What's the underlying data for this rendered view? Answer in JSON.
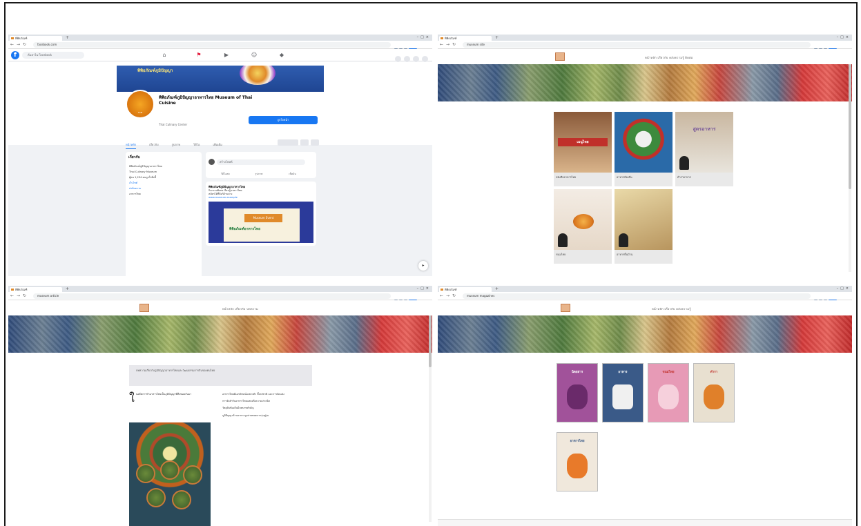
{
  "screens": {
    "facebook": {
      "tab_title": "พิพิธภัณฑ์",
      "url": "facebook.com",
      "search_placeholder": "ค้นหาใน Facebook",
      "cover_title": "พิพิธภัณฑ์ภูมิปัญญา",
      "page_name": "พิพิธภัณฑ์ภูมิปัญญาอาหารไทย Museum of Thai Cuisine",
      "page_subtitle": "Thai Culinary Center",
      "like_button": "ถูกใจหน้า",
      "tabs": [
        "หน้าหลัก",
        "เกี่ยวกับ",
        "รูปภาพ",
        "วิดีโอ",
        "เพิ่มเติม"
      ],
      "about_heading": "เกี่ยวกับ",
      "about_lines": [
        "พิพิธภัณฑ์ภูมิปัญญาอาหารไทย",
        "Thai Culinary Museum",
        "ผู้คน 1,234 คนถูกใจสิ่งนี้",
        "เว็บไซต์",
        "ส่งข้อความ",
        "อาหารไทย"
      ],
      "composer_placeholder": "สร้างโพสต์",
      "composer_actions": [
        "วิดีโอสด",
        "รูปภาพ",
        "เช็คอิน"
      ],
      "post_header": "พิพิธภัณฑ์ภูมิปัญญาอาหารไทย",
      "post_lines": [
        "กิจกรรมพิเศษ เรียนรู้อาหารไทย",
        "สมัครได้ที่ลิงก์ด้านล่าง",
        "www.museum.example"
      ],
      "post_image_title": "Museum Event",
      "post_image_subtitle": "พิพิธภัณฑ์อาหารไทย"
    },
    "books": {
      "tab_title": "พิพิธภัณฑ์",
      "url": "museum site",
      "menu": "หน้าหลัก  เกี่ยวกับ  คลังความรู้  ติดต่อ",
      "items": [
        {
          "title": "เมนูไทย",
          "caption": "หนังสืออาหารไทย"
        },
        {
          "title": "",
          "caption": "อาหารท้องถิ่น"
        },
        {
          "title": "สูตรอาหาร",
          "caption": "ตำราอาหาร"
        },
        {
          "title": "",
          "caption": "ขนมไทย"
        },
        {
          "title": "",
          "caption": "อาหารพื้นบ้าน"
        }
      ]
    },
    "article": {
      "tab_title": "พิพิธภัณฑ์",
      "url": "museum article",
      "menu": "หน้าหลัก  เกี่ยวกับ  บทความ",
      "intro": "บทความเกี่ยวกับภูมิปัญญาอาหารไทยและวัฒนธรรมการกินของคนไทย",
      "dropcap": "ใ",
      "left_paragraph": "นอดีตการทำอาหารไทยเป็นภูมิปัญญาที่สืบทอดกันมา",
      "right_paragraphs": [
        "อาหารไทยมีเอกลักษณ์เฉพาะตัว ทั้งรสชาติ และการจัดแต่ง",
        "การจัดสำรับอาหารไทยแสดงถึงความประณีต",
        "วัตถุดิบท้องถิ่นมีบทบาทสำคัญ",
        "ภูมิปัญญาด้านอาหารถูกถ่ายทอดจากรุ่นสู่รุ่น"
      ]
    },
    "magazines": {
      "tab_title": "พิพิธภัณฑ์",
      "url": "museum magazines",
      "menu": "หน้าหลัก  เกี่ยวกับ  คลังความรู้",
      "items": [
        {
          "title": "นิตยสาร",
          "color": "#a1529a"
        },
        {
          "title": "อาหาร",
          "color": "#3a5a88"
        },
        {
          "title": "ขนมไทย",
          "color": "#e79ab6"
        },
        {
          "title": "ตำรา",
          "color": "#e8e0d0"
        },
        {
          "title": "อาหารไทย",
          "color": "#f0e8dc"
        }
      ]
    }
  }
}
